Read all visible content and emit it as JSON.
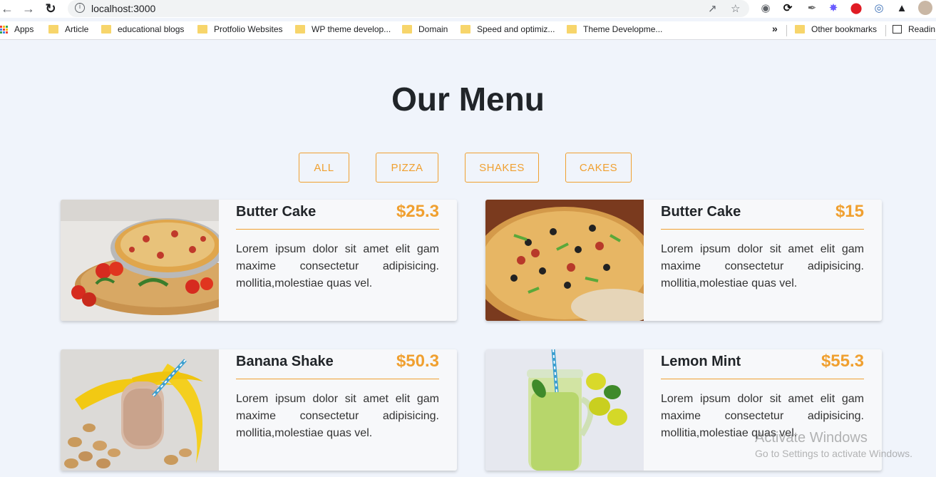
{
  "browser": {
    "url": "localhost:3000",
    "bookmarks": [
      {
        "label": "Apps"
      },
      {
        "label": "Article"
      },
      {
        "label": "educational blogs"
      },
      {
        "label": "Protfolio Websites"
      },
      {
        "label": "WP theme develop..."
      },
      {
        "label": "Domain"
      },
      {
        "label": "Speed and optimiz..."
      },
      {
        "label": "Theme Developme..."
      }
    ],
    "overflow_label": "»",
    "other_bookmarks": "Other bookmarks",
    "reading_list": "Readin"
  },
  "page": {
    "title": "Our Menu",
    "filters": [
      "ALL",
      "PIZZA",
      "SHAKES",
      "CAKES"
    ],
    "accent_color": "#f0a030",
    "items": [
      {
        "name": "Butter Cake",
        "price": "$25.3",
        "description": "Lorem ipsum dolor sit amet elit gam maxime consectetur adipisicing. mollitia,molestiae quas vel.",
        "image": "pizza-tomato-photo"
      },
      {
        "name": "Butter Cake",
        "price": "$15",
        "description": "Lorem ipsum dolor sit amet elit gam maxime consectetur adipisicing. mollitia,molestiae quas vel.",
        "image": "pizza-olive-photo"
      },
      {
        "name": "Banana Shake",
        "price": "$50.3",
        "description": "Lorem ipsum dolor sit amet elit gam maxime consectetur adipisicing. mollitia,molestiae quas vel.",
        "image": "banana-shake-photo"
      },
      {
        "name": "Lemon Mint",
        "price": "$55.3",
        "description": "Lorem ipsum dolor sit amet elit gam maxime consectetur adipisicing. mollitia,molestiae quas vel.",
        "image": "lemon-mint-photo"
      }
    ]
  },
  "watermark": {
    "line1": "Activate Windows",
    "line2": "Go to Settings to activate Windows."
  }
}
